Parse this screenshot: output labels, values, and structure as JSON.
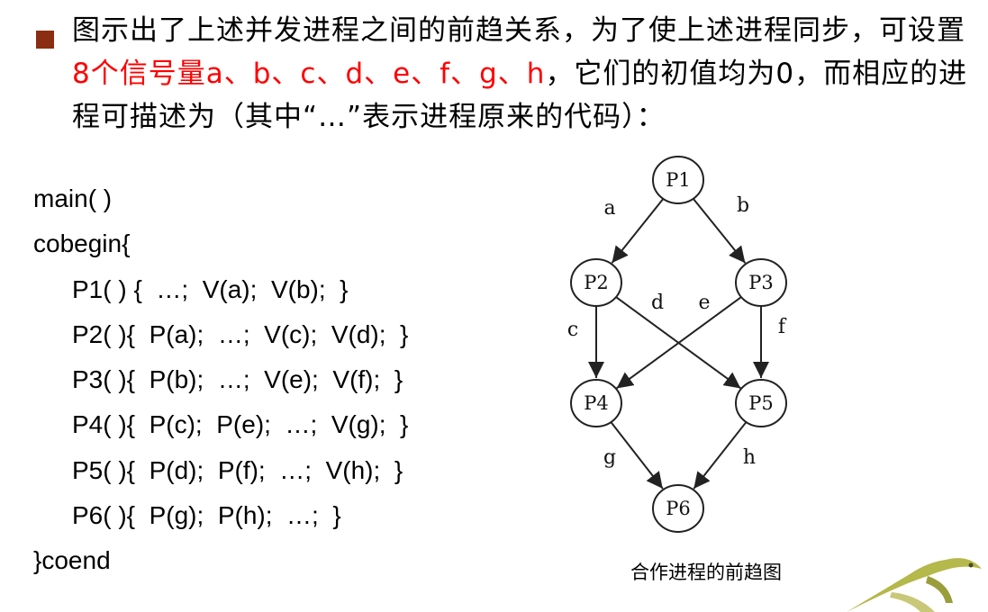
{
  "intro": {
    "pre": "图示出了上述并发进程之间的前趋关系，为了使上述进程同步，可设置",
    "highlight": "8个信号量a、b、c、d、e、f、g、h",
    "post": "，它们的初值均为0，而相应的进程可描述为（其中“…”表示进程原来的代码）："
  },
  "code": {
    "lines": [
      "main( )",
      "cobegin{",
      "P1( ) {  …;  V(a);  V(b);  }",
      "P2( ){  P(a);  …;  V(c);  V(d);  }",
      "P3( ){  P(b);  …;  V(e);  V(f);  }",
      "P4( ){  P(c);  P(e);  …;  V(g);  }",
      "P5( ){  P(d);  P(f);  …;  V(h);  }",
      "P6( ){  P(g);  P(h);  …;  }",
      "}coend"
    ]
  },
  "diagram": {
    "nodes": [
      "P1",
      "P2",
      "P3",
      "P4",
      "P5",
      "P6"
    ],
    "edges": [
      {
        "label": "a",
        "from": "P1",
        "to": "P2"
      },
      {
        "label": "b",
        "from": "P1",
        "to": "P3"
      },
      {
        "label": "c",
        "from": "P2",
        "to": "P4"
      },
      {
        "label": "d",
        "from": "P2",
        "to": "P5"
      },
      {
        "label": "e",
        "from": "P3",
        "to": "P4"
      },
      {
        "label": "f",
        "from": "P3",
        "to": "P5"
      },
      {
        "label": "g",
        "from": "P4",
        "to": "P6"
      },
      {
        "label": "h",
        "from": "P5",
        "to": "P6"
      }
    ],
    "caption": "合作进程的前趋图"
  },
  "decoration": {
    "icon": "lizard-icon"
  }
}
